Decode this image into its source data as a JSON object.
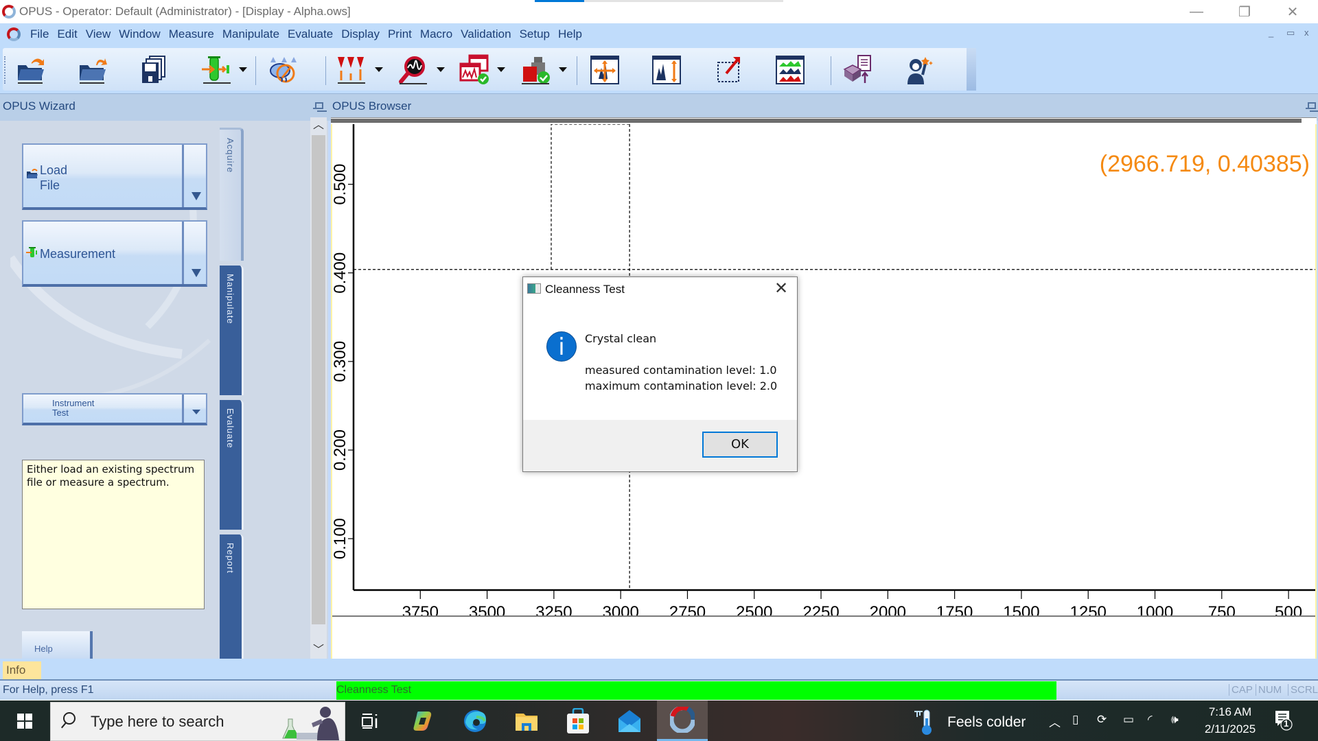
{
  "window": {
    "title": "OPUS - Operator: Default  (Administrator) - [Display - Alpha.ows]",
    "minimize_label": "—",
    "restore_label": "❐",
    "close_label": "✕"
  },
  "menu": {
    "items": [
      "File",
      "Edit",
      "View",
      "Window",
      "Measure",
      "Manipulate",
      "Evaluate",
      "Display",
      "Print",
      "Macro",
      "Validation",
      "Setup",
      "Help"
    ],
    "mdi_minimize": "_",
    "mdi_restore": "▭",
    "mdi_close": "x"
  },
  "toolbar": {
    "buttons": [
      {
        "icon": "open-file-icon",
        "dropdown": false
      },
      {
        "icon": "load-file-icon",
        "dropdown": false
      },
      {
        "icon": "save-icon",
        "dropdown": false
      },
      {
        "icon": "measure-icon",
        "dropdown": true
      },
      {
        "icon": "atmospheric-compensation-icon",
        "dropdown": false
      },
      {
        "icon": "peak-pick-icon",
        "dropdown": true
      },
      {
        "icon": "search-spectrum-icon",
        "dropdown": true
      },
      {
        "icon": "validation-icon",
        "dropdown": true
      },
      {
        "icon": "instrument-test-icon",
        "dropdown": true
      },
      {
        "icon": "scale-all-icon",
        "dropdown": false
      },
      {
        "icon": "scale-y-icon",
        "dropdown": false
      },
      {
        "icon": "zoom-region-icon",
        "dropdown": false
      },
      {
        "icon": "overlay-spectra-icon",
        "dropdown": false
      },
      {
        "icon": "print-report-icon",
        "dropdown": false
      },
      {
        "icon": "wizard-assistant-icon",
        "dropdown": false
      }
    ]
  },
  "wizard": {
    "header": "OPUS Wizard",
    "buttons": {
      "load_file_line1": "Load",
      "load_file_line2": "File",
      "measurement": "Measurement",
      "instrument_test_line1": "Instrument",
      "instrument_test_line2": "Test"
    },
    "tabs": [
      {
        "label": "Acquire",
        "active": true
      },
      {
        "label": "Manipulate",
        "active": false
      },
      {
        "label": "Evaluate",
        "active": false
      },
      {
        "label": "Report",
        "active": false
      }
    ],
    "info_text": "Either load an existing spectrum file or measure a spectrum.",
    "help_label": "Help"
  },
  "browser": {
    "header": "OPUS Browser",
    "coordinate_readout": "(2966.719, 0.40385)",
    "doc_tab": "Display - Alpha.ows"
  },
  "chart_data": {
    "type": "line",
    "title": "",
    "xlabel": "",
    "ylabel": "",
    "series": [],
    "xlim": [
      4000,
      400
    ],
    "ylim": [
      0.042,
      0.574
    ],
    "x_ticks": [
      3750,
      3500,
      3250,
      3000,
      2750,
      2500,
      2250,
      2000,
      1750,
      1500,
      1250,
      1000,
      750,
      500
    ],
    "x_tick_labels": [
      "3750",
      "3500",
      "3250",
      "3000",
      "2750",
      "2500",
      "2250",
      "2000",
      "1750",
      "1500",
      "1250",
      "1000",
      "750",
      "500"
    ],
    "y_ticks": [
      0.1,
      0.2,
      0.3,
      0.4,
      0.5
    ],
    "y_tick_labels": [
      "0.100",
      "0.200",
      "0.300",
      "0.400",
      "0.500"
    ],
    "crosshair": {
      "x": 2966.719,
      "y": 0.40385
    },
    "selection_box": {
      "x_from": 3260,
      "x_to": 2966.719
    },
    "grid": false,
    "x_reversed": true
  },
  "info_bar": {
    "tab": "Info"
  },
  "status": {
    "help": "For Help, press F1",
    "task": "Cleanness Test",
    "progress_fraction": 0.81,
    "indicators": [
      "CAP",
      "NUM",
      "SCRL"
    ]
  },
  "dialog": {
    "title": "Cleanness Test",
    "icon": "information-icon",
    "heading": "Crystal clean",
    "line1": "measured contamination level: 1.0",
    "line2": "maximum contamination level: 2.0",
    "ok_label": "OK",
    "close_label": "✕"
  },
  "taskbar": {
    "search_placeholder": "Type here to search",
    "pinned": [
      "task-view",
      "copilot",
      "edge",
      "file-explorer",
      "microsoft-store",
      "mail",
      "opus"
    ],
    "active_app": "opus",
    "weather": "Feels colder",
    "time": "7:16 AM",
    "date": "2/11/2025",
    "notification_count": "1"
  }
}
